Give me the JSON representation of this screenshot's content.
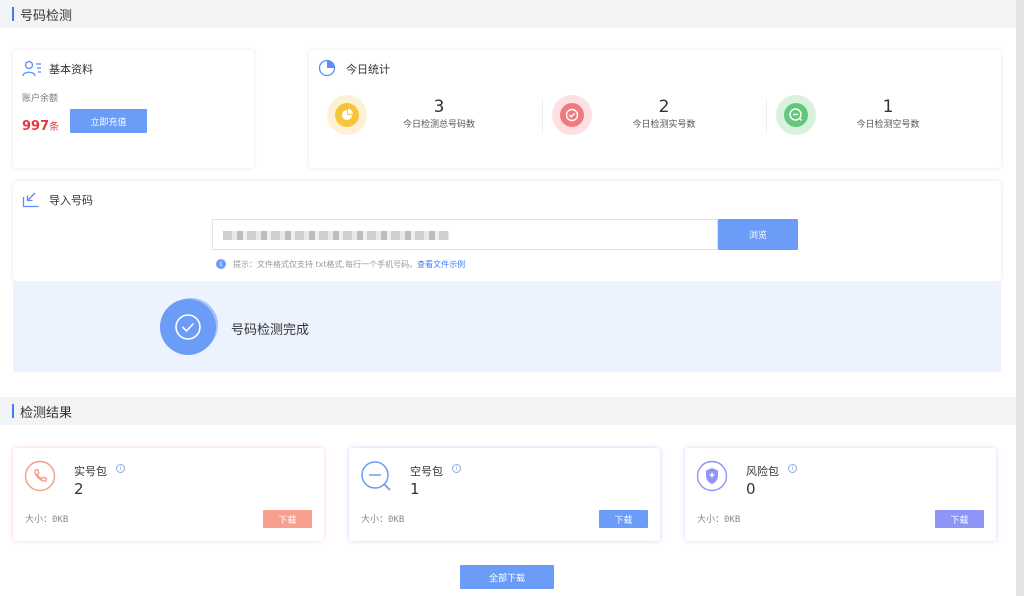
{
  "sections": {
    "number_check": "号码检测",
    "results": "检测结果"
  },
  "basic_info": {
    "title": "基本资料",
    "balance_label": "账户余额",
    "balance_value": "997",
    "balance_unit": "条",
    "recharge_button": "立即充值"
  },
  "today_stats": {
    "title": "今日统计",
    "items": [
      {
        "value": "3",
        "label": "今日检测总号码数",
        "color": "#f8c43c"
      },
      {
        "value": "2",
        "label": "今日检测实号数",
        "color": "#f27981"
      },
      {
        "value": "1",
        "label": "今日检测空号数",
        "color": "#63c77d"
      }
    ]
  },
  "import": {
    "title": "导入号码",
    "browse_button": "浏览",
    "hint": "提示：文件格式仅支持 txt格式,每行一个手机号码。",
    "hint_link": "查看文件示例"
  },
  "status": {
    "message": "号码检测完成"
  },
  "results": {
    "items": [
      {
        "title": "实号包",
        "count": "2",
        "size": "大小：0KB",
        "download": "下载",
        "color": "#f59a88"
      },
      {
        "title": "空号包",
        "count": "1",
        "size": "大小：0KB",
        "download": "下载",
        "color": "#6a9cf8"
      },
      {
        "title": "风险包",
        "count": "0",
        "size": "大小：0KB",
        "download": "下载",
        "color": "#8f95f6"
      }
    ],
    "download_all": "全部下载"
  },
  "icons": {
    "basic_info": "user-list-icon",
    "today_stats": "pie-chart-icon",
    "import": "arrow-import-icon",
    "status": "check-circle-icon",
    "info": "info-icon"
  }
}
